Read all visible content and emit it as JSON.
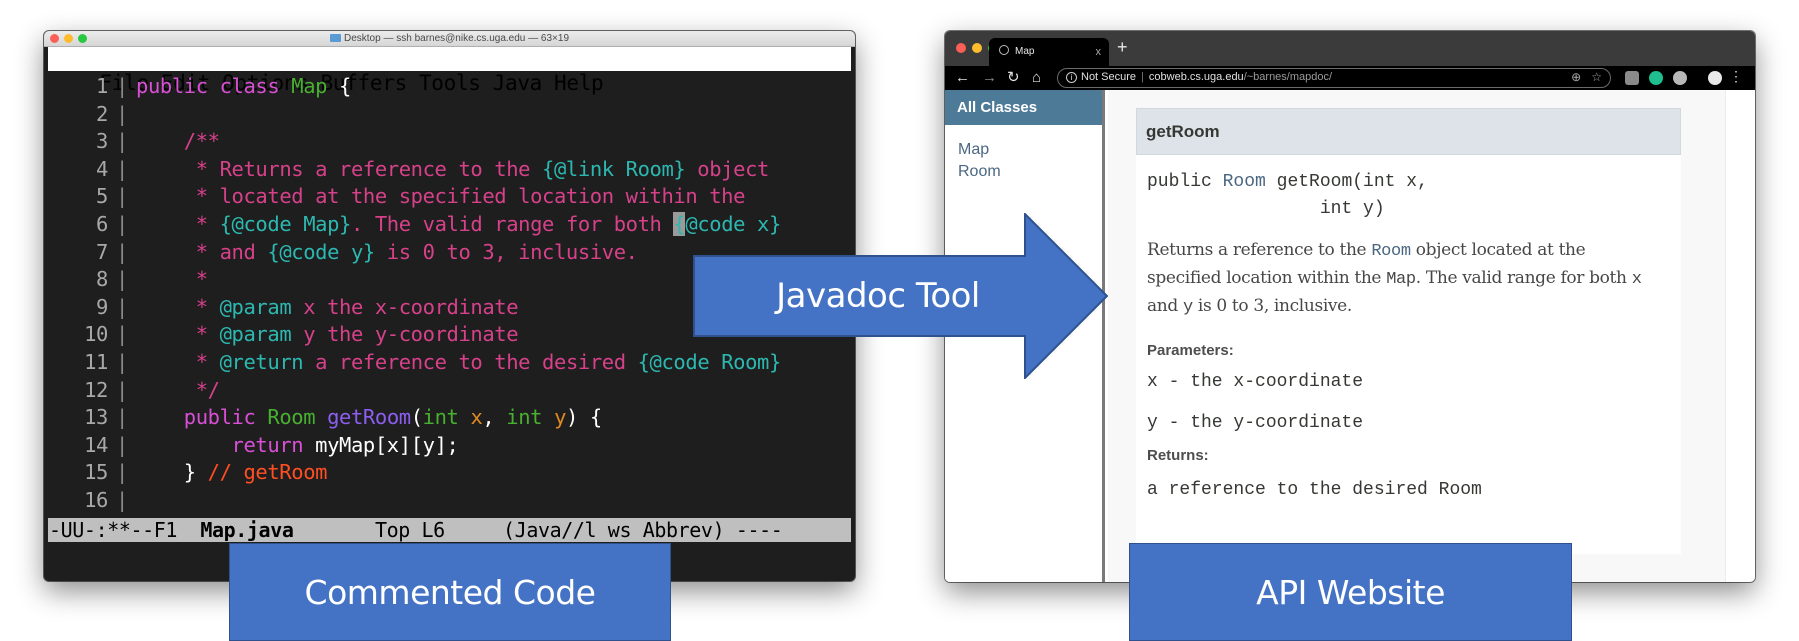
{
  "terminal": {
    "title": "Desktop — ssh barnes@nike.cs.uga.edu — 63×19",
    "menu": [
      "File",
      "Edit",
      "Options",
      "Buffers",
      "Tools",
      "Java",
      "Help"
    ],
    "lines": [
      {
        "n": "1",
        "parts": [
          [
            "kw",
            "public class "
          ],
          [
            "ty",
            "Map"
          ],
          [
            "pl",
            " {"
          ]
        ]
      },
      {
        "n": "2",
        "parts": []
      },
      {
        "n": "3",
        "parts": [
          [
            "pl",
            "    "
          ],
          [
            "cm",
            "/**"
          ]
        ]
      },
      {
        "n": "4",
        "parts": [
          [
            "pl",
            "     "
          ],
          [
            "cm",
            "* Returns a reference to the "
          ],
          [
            "tag",
            "{@link Room}"
          ],
          [
            "cm",
            " object"
          ]
        ]
      },
      {
        "n": "5",
        "parts": [
          [
            "pl",
            "     "
          ],
          [
            "cm",
            "* located at the specified location within the"
          ]
        ]
      },
      {
        "n": "6",
        "parts": [
          [
            "pl",
            "     "
          ],
          [
            "cm",
            "* "
          ],
          [
            "tag",
            "{@code Map}"
          ],
          [
            "cm",
            ". The valid range for both "
          ],
          [
            "cursor",
            "{"
          ],
          [
            "tag",
            "@code x}"
          ]
        ]
      },
      {
        "n": "7",
        "parts": [
          [
            "pl",
            "     "
          ],
          [
            "cm",
            "* and "
          ],
          [
            "tag",
            "{@code y}"
          ],
          [
            "cm",
            " is 0 to 3, inclusive."
          ]
        ]
      },
      {
        "n": "8",
        "parts": [
          [
            "pl",
            "     "
          ],
          [
            "cm",
            "*"
          ]
        ]
      },
      {
        "n": "9",
        "parts": [
          [
            "pl",
            "     "
          ],
          [
            "cm",
            "* "
          ],
          [
            "tag",
            "@param"
          ],
          [
            "cm",
            " x the x-coordinate"
          ]
        ]
      },
      {
        "n": "10",
        "parts": [
          [
            "pl",
            "     "
          ],
          [
            "cm",
            "* "
          ],
          [
            "tag",
            "@param"
          ],
          [
            "cm",
            " y the y-coordinate"
          ]
        ]
      },
      {
        "n": "11",
        "parts": [
          [
            "pl",
            "     "
          ],
          [
            "cm",
            "* "
          ],
          [
            "tag",
            "@return"
          ],
          [
            "cm",
            " a reference to the desired "
          ],
          [
            "tag",
            "{@code Room}"
          ]
        ]
      },
      {
        "n": "12",
        "parts": [
          [
            "pl",
            "     "
          ],
          [
            "cm",
            "*/"
          ]
        ]
      },
      {
        "n": "13",
        "parts": [
          [
            "pl",
            "    "
          ],
          [
            "kw",
            "public "
          ],
          [
            "ty",
            "Room "
          ],
          [
            "fn",
            "getRoom"
          ],
          [
            "pl",
            "("
          ],
          [
            "ty",
            "int "
          ],
          [
            "var",
            "x"
          ],
          [
            "pl",
            ", "
          ],
          [
            "ty",
            "int "
          ],
          [
            "var",
            "y"
          ],
          [
            "pl",
            ") {"
          ]
        ]
      },
      {
        "n": "14",
        "parts": [
          [
            "pl",
            "        "
          ],
          [
            "kw",
            "return "
          ],
          [
            "pl",
            "myMap[x][y];"
          ]
        ]
      },
      {
        "n": "15",
        "parts": [
          [
            "pl",
            "    } "
          ],
          [
            "lc",
            "// getRoom"
          ]
        ]
      },
      {
        "n": "16",
        "parts": []
      }
    ],
    "modeline": {
      "prefix": "-UU-:**--F1  ",
      "buffer": "Map.java",
      "position": "       Top L6     ",
      "mode": "(Java//l ws Abbrev) ----"
    }
  },
  "browser": {
    "tab_title": "Map",
    "tab_close": "x",
    "new_tab": "+",
    "security_label": "Not Secure",
    "url_host": "cobweb.cs.uga.edu",
    "url_path": "/~barnes/mapdoc/",
    "sidebar": {
      "heading": "All Classes",
      "links": [
        "Map",
        "Room"
      ]
    },
    "member": {
      "name": "getRoom",
      "signature_line1_a": "public ",
      "signature_type": "Room",
      "signature_line1_b": " getRoom(int x,",
      "signature_line2": "                int y)",
      "description": {
        "t1": "Returns a reference to the ",
        "link": "Room",
        "t2": " object located at the specified location within the ",
        "code_map": "Map",
        "t3": ". The valid range for both ",
        "code_x": "x",
        "t4": " and ",
        "code_y": "y",
        "t5": " is 0 to 3, inclusive."
      },
      "parameters_label": "Parameters:",
      "parameters": [
        "x - the x-coordinate",
        "y - the y-coordinate"
      ],
      "returns_label": "Returns:",
      "returns": "a reference to the desired Room"
    }
  },
  "overlays": {
    "arrow_label": "Javadoc Tool",
    "left_label": "Commented Code",
    "right_label": "API Website",
    "accent_color": "#4472c4"
  }
}
